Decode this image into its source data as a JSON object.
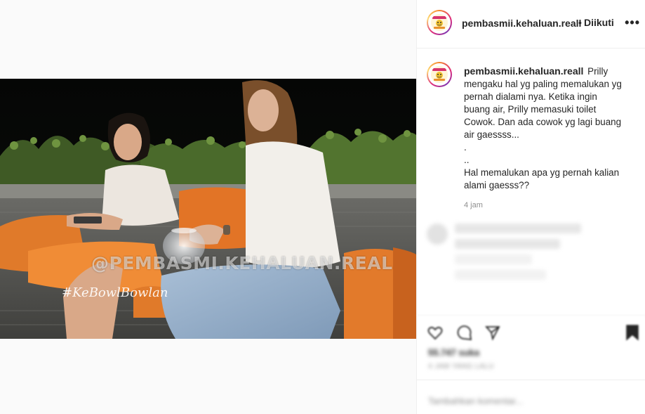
{
  "post": {
    "username": "pembasmii.kehaluan.reall",
    "separator": "•",
    "follow_label": "Diikuti",
    "more_label": "•••",
    "caption_lines": [
      "Prilly",
      "mengaku hal yg paling memalukan yg",
      "pernah dialami nya. Ketika ingin",
      "buang air, Prilly memasuki toilet",
      "Cowok. Dan ada cowok yg lagi buang",
      "air gaessss...",
      ".",
      "..",
      "Hal memalukan apa yg pernah kalian",
      "alami gaesss??"
    ],
    "time_ago": "4 jam",
    "likes": "55.747 suka",
    "date": "4 JAM YANG LALU",
    "comment_placeholder": "Tambahkan komentar..."
  },
  "video": {
    "watermark": "@PEMBASMI.KEHALUAN.REAL",
    "show_logo": "#KeBowlBowlan"
  },
  "icons": {
    "heart": "heart-icon",
    "comment": "comment-icon",
    "share": "share-icon",
    "save": "bookmark-icon",
    "more": "more-icon"
  },
  "colors": {
    "text": "#262626",
    "muted": "#8e8e8e",
    "border": "#efefef",
    "cushion": "#e07a2a"
  }
}
